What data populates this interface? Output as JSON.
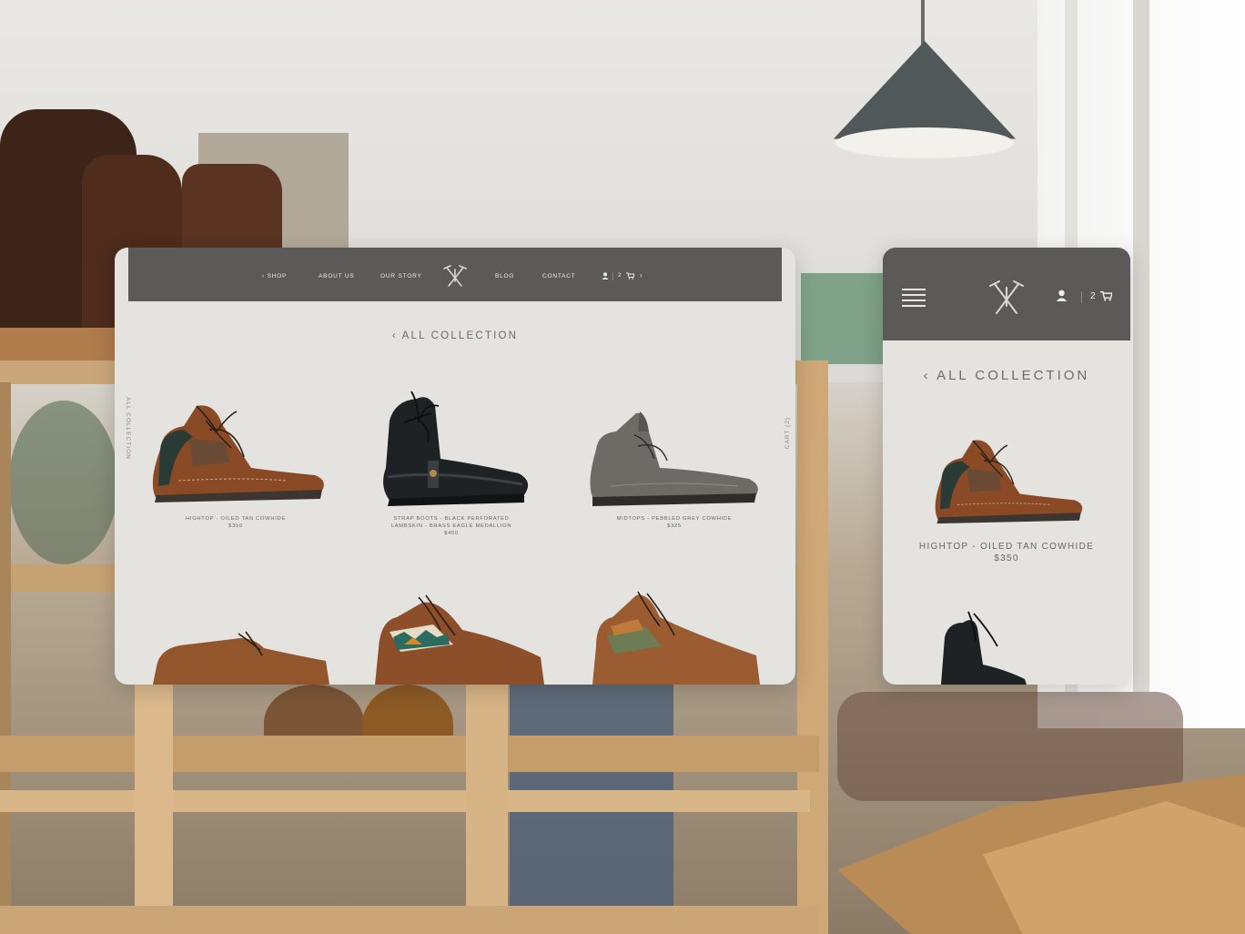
{
  "desktop": {
    "nav": {
      "shop": "‹  SHOP",
      "about": "ABOUT US",
      "story": "OUR STORY",
      "blog": "BLOG",
      "contact": "CONTACT",
      "cart_count": "2",
      "next_arrow": "›"
    },
    "collection_title": "‹ ALL COLLECTION",
    "side_left": "ALL COLLECTION",
    "side_right": "CART (2)",
    "products": [
      {
        "name": "HIGHTOP - OILED TAN COWHIDE",
        "price": "$350"
      },
      {
        "name_line1": "STRAP BOOTS - BLACK PERFORATED",
        "name_line2": "LAMBSKIN - BRASS EAGLE MEDALLION",
        "price": "$450"
      },
      {
        "name": "MIDTOPS - PEBBLED GREY COWHIDE",
        "price": "$325"
      }
    ]
  },
  "mobile": {
    "cart_count": "2",
    "collection_title": "‹ ALL COLLECTION",
    "product": {
      "name": "HIGHTOP - OILED TAN COWHIDE",
      "price": "$350"
    }
  },
  "colors": {
    "nav_bg": "#5b5a58",
    "page_bg": "#e5e3df",
    "text_muted": "#6e6b66"
  },
  "icons": [
    "logo-crossed-hammers-icon",
    "user-icon",
    "cart-icon",
    "hamburger-menu-icon",
    "chevron-left-icon",
    "chevron-right-icon"
  ]
}
